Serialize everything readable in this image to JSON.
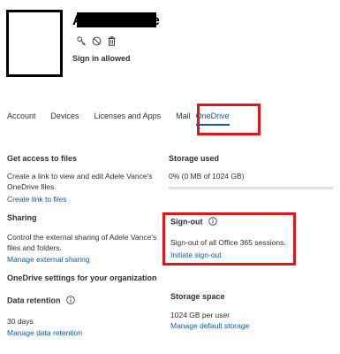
{
  "user": {
    "name_first_letter": "A",
    "name_last_letter": "e",
    "status": "Sign in allowed"
  },
  "icons": [
    "key-icon",
    "block-icon",
    "trash-icon",
    "info-icon"
  ],
  "tabs": [
    {
      "label": "Account",
      "active": false
    },
    {
      "label": "Devices",
      "active": false
    },
    {
      "label": "Licenses and Apps",
      "active": false
    },
    {
      "label": "Mail",
      "active": false
    },
    {
      "label": "OneDrive",
      "active": true
    }
  ],
  "files": {
    "heading": "Get access to files",
    "desc_line1": "Create a link to view and edit Adele Vance's",
    "desc_line2": "OneDrive files.",
    "link": "Create link to files"
  },
  "storage_used": {
    "heading": "Storage used",
    "value": "0% (0 MB of 1024 GB)",
    "percent": 0
  },
  "sharing": {
    "heading": "Sharing",
    "desc_line1": "Control the external sharing of Adele Vance's",
    "desc_line2": "files and folders.",
    "link": "Manage external sharing"
  },
  "signout": {
    "heading": "Sign-out",
    "desc": "Sign-out of all Office 365 sessions.",
    "link": "Initiate sign-out"
  },
  "settings": {
    "heading": "OneDrive settings for your organization"
  },
  "retention": {
    "heading": "Data retention",
    "value": "30 days",
    "link": "Manage data retention"
  },
  "storage_space": {
    "heading": "Storage space",
    "value": "1024 GB per user",
    "link": "Manage default storage"
  },
  "colors": {
    "accent": "#0f5ba8",
    "highlight": "#e0161b",
    "text": "#323130"
  }
}
